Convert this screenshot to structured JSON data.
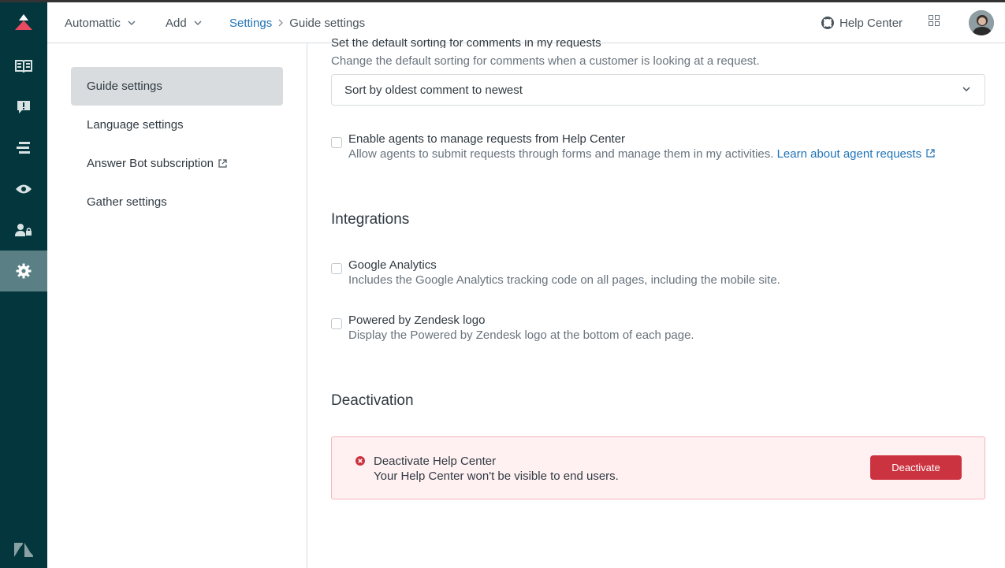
{
  "colors": {
    "rail": "#03363d",
    "accent": "#1f73b7",
    "danger": "#cc3340",
    "active_rail": "#5a7f84"
  },
  "topbar": {
    "account_menu": "Automattic",
    "add_menu": "Add",
    "breadcrumb_settings": "Settings",
    "breadcrumb_current": "Guide settings",
    "help_center": "Help Center"
  },
  "rail": {
    "items": [
      "knowledge-icon",
      "alert-icon",
      "arrange-icon",
      "eye-icon",
      "user-lock-icon",
      "gear-icon"
    ]
  },
  "sidenav": {
    "items": [
      "Guide settings",
      "Language settings",
      "Answer Bot subscription",
      "Gather settings"
    ]
  },
  "requests": {
    "sorting_title": "Set the default sorting for comments in my requests",
    "sorting_desc": "Change the default sorting for comments when a customer is looking at a request.",
    "sorting_value": "Sort by oldest comment to newest",
    "agents_title": "Enable agents to manage requests from Help Center",
    "agents_desc": "Allow agents to submit requests through forms and manage them in my activities.",
    "agents_link": "Learn about agent requests"
  },
  "integrations": {
    "heading": "Integrations",
    "ga_title": "Google Analytics",
    "ga_desc": "Includes the Google Analytics tracking code on all pages, including the mobile site.",
    "powered_title": "Powered by Zendesk logo",
    "powered_desc": "Display the Powered by Zendesk logo at the bottom of each page."
  },
  "deactivation": {
    "heading": "Deactivation",
    "title": "Deactivate Help Center",
    "desc": "Your Help Center won't be visible to end users.",
    "button": "Deactivate"
  }
}
